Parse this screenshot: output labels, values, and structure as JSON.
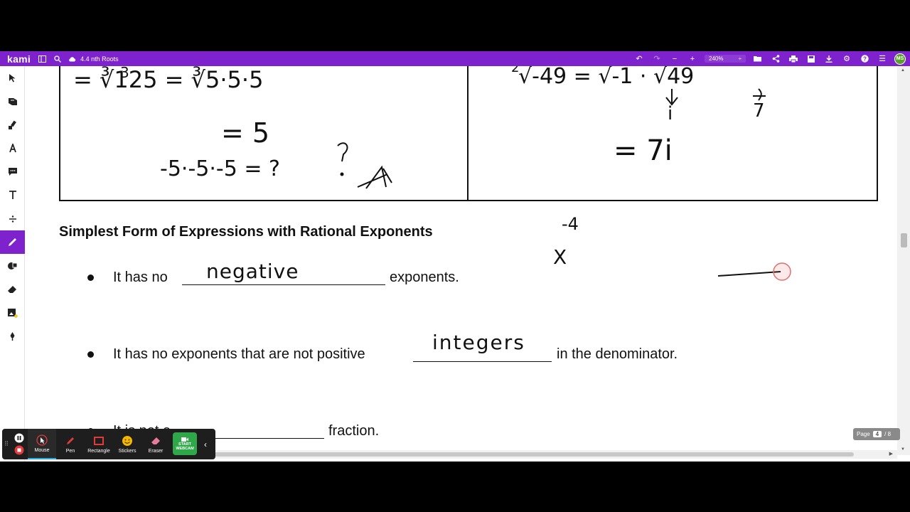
{
  "topbar": {
    "logo": "kami",
    "doc_title": "4.4 nth Roots",
    "zoom": "240%",
    "zoom_caret": "÷",
    "avatar": "MS"
  },
  "lefttools": [
    "select",
    "reading",
    "highlight",
    "underline-text",
    "comment",
    "text",
    "equation",
    "pen",
    "shapes",
    "eraser",
    "add-media",
    "signature"
  ],
  "palette": {
    "size": "1",
    "colors": [
      "#000000",
      "#f5f31a",
      "#d01ee0"
    ]
  },
  "document": {
    "table_left": {
      "hw_line1_prefix": "3",
      "hw_line1": "= ∛125 = ∛5·5·5",
      "hw_line2": "= 5",
      "hw_line3": "-5·-5·-5 = ?"
    },
    "table_right": {
      "hw_line1_prefix": "2",
      "hw_line1": "√-49 = √-1 · √49",
      "hw_i": "i",
      "hw_seven": "7",
      "hw_result": "= 7i"
    },
    "heading": "Simplest Form of Expressions with Rational Exponents",
    "bullets": [
      {
        "before": "It has no",
        "fill": "negative",
        "after": "exponents."
      },
      {
        "before": "It has no exponents that are not positive",
        "fill": "integers",
        "after": "in the denominator."
      },
      {
        "before": "It is not a",
        "fill": "",
        "after": "fraction."
      }
    ],
    "margin_note_exp": "-4",
    "margin_note_base": "X"
  },
  "pager": {
    "label": "Page",
    "current": "4",
    "total": "/ 8"
  },
  "recorder": {
    "buttons": [
      {
        "label": "Mouse"
      },
      {
        "label": "Pen"
      },
      {
        "label": "Rectangle"
      },
      {
        "label": "Stickers"
      },
      {
        "label": "Eraser"
      }
    ],
    "webcam_line1": "START",
    "webcam_line2": "WEBCAM"
  }
}
